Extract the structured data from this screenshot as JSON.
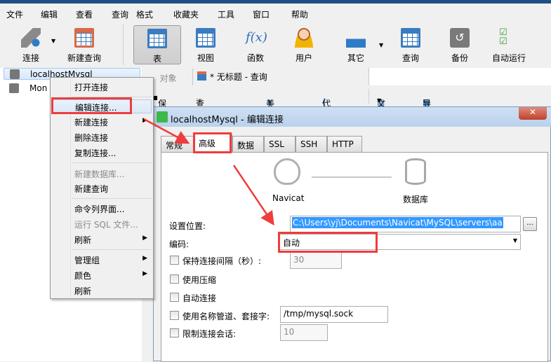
{
  "menu": [
    "文件",
    "编辑",
    "查看",
    "查询",
    "格式",
    "收藏夹",
    "工具",
    "窗口",
    "帮助"
  ],
  "toolbar": {
    "connect": "连接",
    "new_query": "新建查询",
    "table": "表",
    "view": "视图",
    "function": "函数",
    "user": "用户",
    "other": "其它",
    "query": "查询",
    "backup": "备份",
    "autorun": "自动运行"
  },
  "tree": {
    "items": [
      "localhostMysql",
      "Mon"
    ]
  },
  "tabs": {
    "objects": "对象",
    "query": "* 无标题 - 查询"
  },
  "query_toolbar": {
    "save": "保存",
    "builder": "查询创建工具",
    "beautify": "美化 SQL",
    "snippet": "代码段",
    "text": "文本",
    "export": "导出结果"
  },
  "context_menu": {
    "items": [
      "打开连接",
      "编辑连接...",
      "新建连接",
      "删除连接",
      "复制连接...",
      "新建数据库...",
      "新建查询",
      "命令列界面...",
      "运行 SQL 文件...",
      "刷新",
      "管理组",
      "颜色",
      "刷新"
    ]
  },
  "dialog": {
    "title": "localhostMysql - 编辑连接",
    "close": "✕",
    "tabs": [
      "常规",
      "高级",
      "数据库",
      "SSL",
      "SSH",
      "HTTP"
    ],
    "active_tab": "高级",
    "diagram": {
      "left": "Navicat",
      "right": "数据库"
    },
    "settings_location_label": "设置位置:",
    "settings_location_value": "C:\\Users\\yj\\Documents\\Navicat\\MySQL\\servers\\aa",
    "browse": "...",
    "encoding_label": "编码:",
    "encoding_value": "自动",
    "keepalive_label": "保持连接间隔（秒）:",
    "keepalive_value": "30",
    "compression_label": "使用压缩",
    "autoconnect_label": "自动连接",
    "pipe_label": "使用名称管道、套接字:",
    "pipe_value": "/tmp/mysql.sock",
    "limit_label": "限制连接会话:",
    "limit_value": "10"
  },
  "colors": {
    "annotation": "#f03c3c",
    "accent": "#3a7cc0",
    "selection": "#3399ff"
  }
}
